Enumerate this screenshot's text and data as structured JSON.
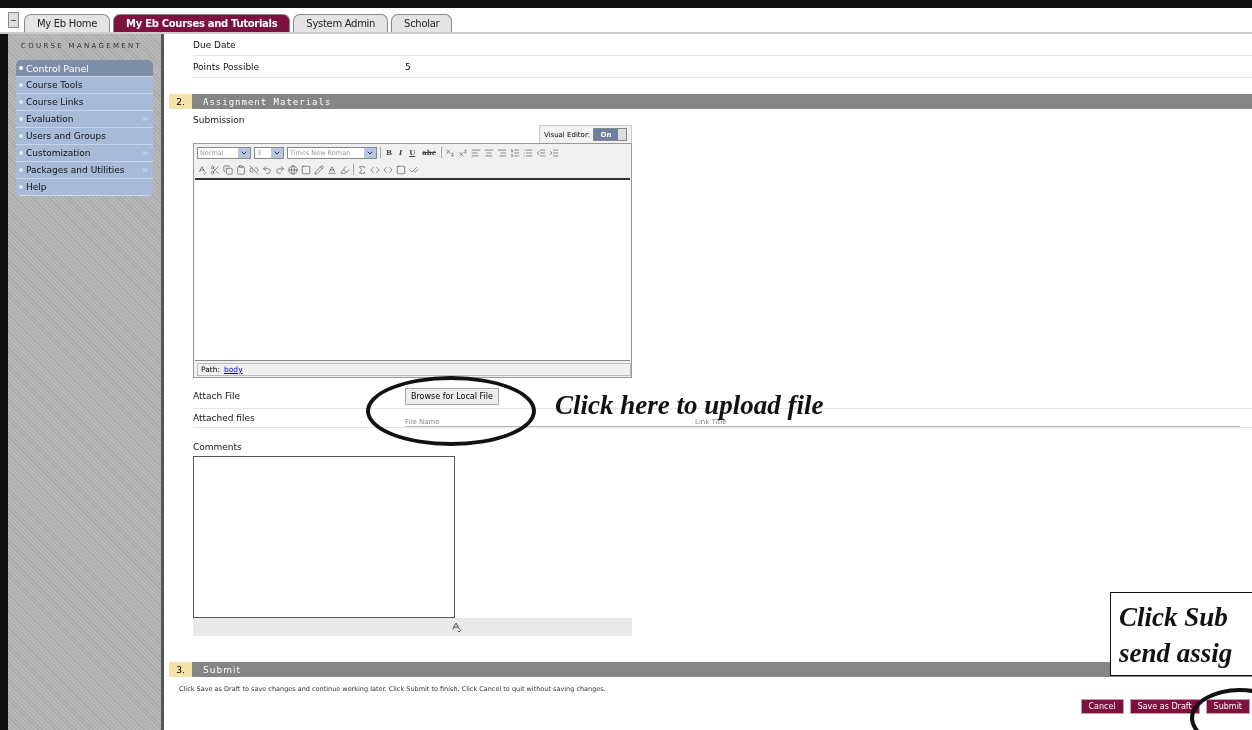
{
  "tabs": [
    {
      "label": "My Eb Home",
      "selected": false
    },
    {
      "label": "My Eb Courses and Tutorials",
      "selected": true
    },
    {
      "label": "System Admin",
      "selected": false
    },
    {
      "label": "Scholar",
      "selected": false
    }
  ],
  "sidebar": {
    "title": "COURSE MANAGEMENT",
    "items": [
      {
        "label": "Control Panel",
        "selected": true,
        "submenu": false
      },
      {
        "label": "Course Tools",
        "selected": false,
        "submenu": false
      },
      {
        "label": "Course Links",
        "selected": false,
        "submenu": false
      },
      {
        "label": "Evaluation",
        "selected": false,
        "submenu": true
      },
      {
        "label": "Users and Groups",
        "selected": false,
        "submenu": false
      },
      {
        "label": "Customization",
        "selected": false,
        "submenu": true
      },
      {
        "label": "Packages and Utilities",
        "selected": false,
        "submenu": true
      },
      {
        "label": "Help",
        "selected": false,
        "submenu": false
      }
    ]
  },
  "fields": [
    {
      "label": "Due Date"
    },
    {
      "label": "Points Possible",
      "value": "5"
    }
  ],
  "materials": {
    "number": "2.",
    "title": "Assignment Materials",
    "submission_label": "Submission",
    "visual_editor": {
      "label": "Visual Editor:",
      "state": "On",
      "on": true
    },
    "selects": [
      "Normal",
      "3",
      "Times New Roman"
    ],
    "format_buttons": [
      "B",
      "I",
      "U",
      "abc"
    ],
    "path_label": "Path:",
    "path_link": "body",
    "attach_label": "Attach File",
    "browse_button": "Browse for Local File",
    "attached_label": "Attached files",
    "attached_columns": [
      "File Name",
      "Link Title"
    ],
    "comments_label": "Comments"
  },
  "submit": {
    "number": "3.",
    "title": "Submit",
    "instructions": "Click Save as Draft to save changes and continue working later. Click Submit to finish. Click Cancel to quit without saving changes.",
    "buttons": [
      "Cancel",
      "Save as Draft",
      "Submit"
    ]
  },
  "annotations": {
    "upload_note": "Click here to upload file",
    "submit_note": [
      "Click Sub",
      "send assig"
    ]
  }
}
